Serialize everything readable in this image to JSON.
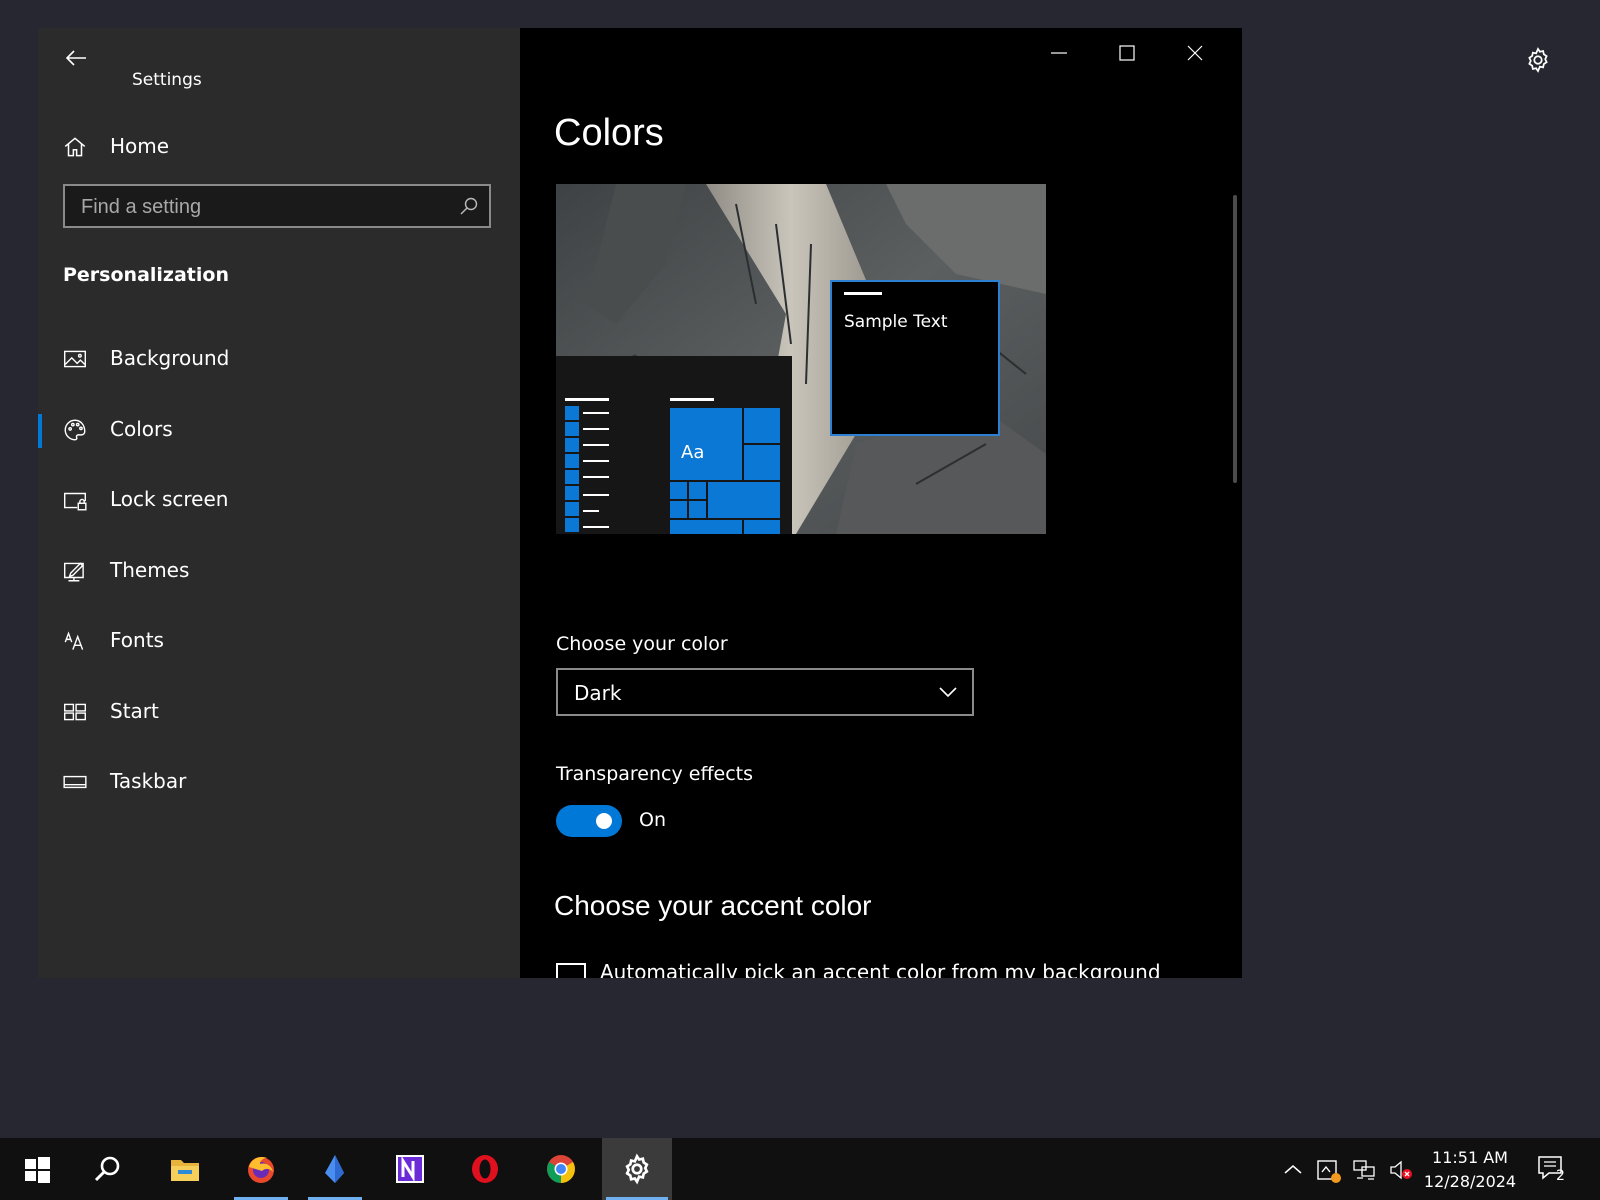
{
  "window": {
    "app_title": "Settings",
    "search_placeholder": "Find a setting",
    "home_label": "Home",
    "section_title": "Personalization"
  },
  "sidebar": {
    "items": [
      {
        "label": "Background",
        "icon": "image-icon"
      },
      {
        "label": "Colors",
        "icon": "palette-icon",
        "selected": true
      },
      {
        "label": "Lock screen",
        "icon": "lock-screen-icon"
      },
      {
        "label": "Themes",
        "icon": "themes-icon"
      },
      {
        "label": "Fonts",
        "icon": "fonts-icon"
      },
      {
        "label": "Start",
        "icon": "start-icon"
      },
      {
        "label": "Taskbar",
        "icon": "taskbar-icon"
      }
    ]
  },
  "main": {
    "page_title": "Colors",
    "preview": {
      "sample_text": "Sample Text",
      "tile_text": "Aa"
    },
    "choose_color_label": "Choose your color",
    "choose_color_value": "Dark",
    "transparency_label": "Transparency effects",
    "transparency_state": "On",
    "accent_heading": "Choose your accent color",
    "auto_pick_label": "Automatically pick an accent color from my background"
  },
  "colors": {
    "accent": "#0078d7",
    "nav_bg": "#2b2b2b",
    "content_bg": "#000000",
    "desktop_bg": "#262730"
  },
  "taskbar": {
    "apps": [
      "start-icon",
      "search-icon",
      "file-explorer-icon",
      "firefox-icon",
      "app-crystal-icon",
      "app-n-icon",
      "opera-icon",
      "chrome-icon",
      "settings-icon"
    ],
    "time": "11:51 AM",
    "date": "12/28/2024",
    "notification_count": "2"
  }
}
